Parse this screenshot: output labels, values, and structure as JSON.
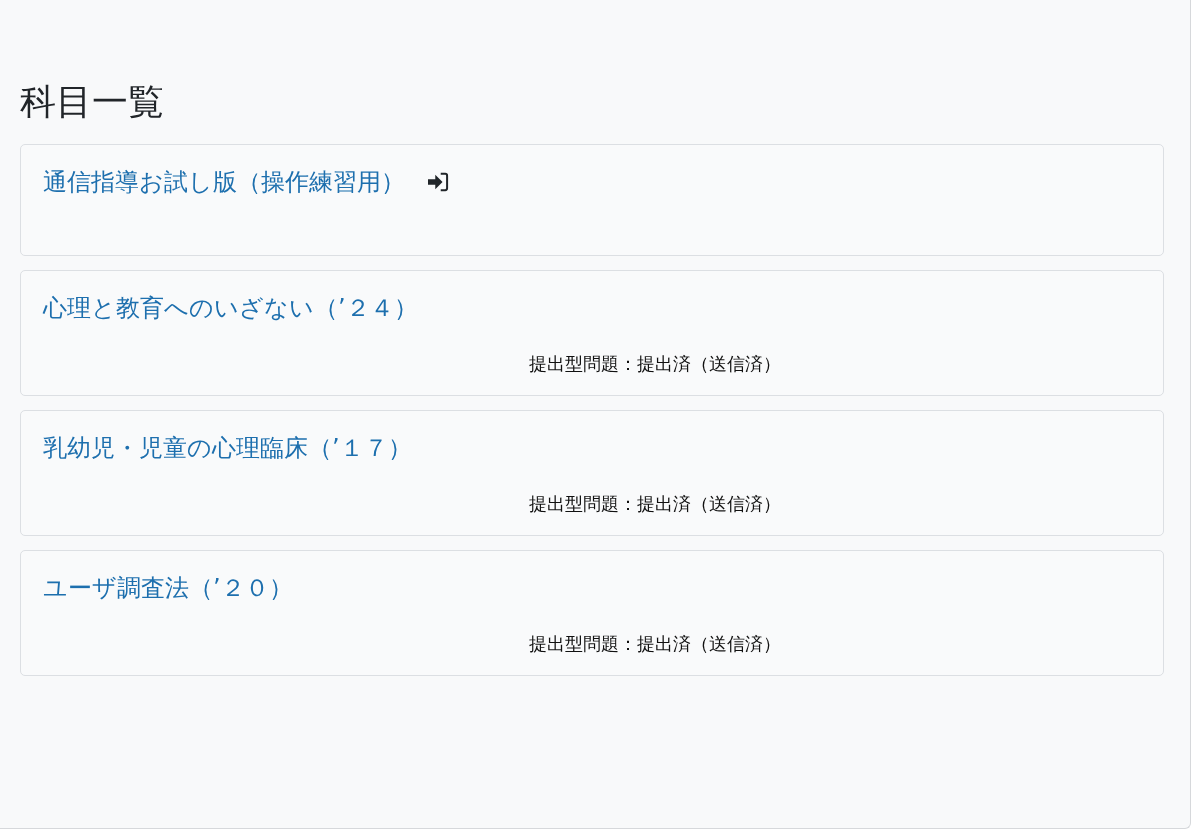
{
  "heading": "科目一覧",
  "courses": [
    {
      "title": "通信指導お試し版（操作練習用）",
      "enter_icon": true
    },
    {
      "title": "心理と教育へのいざない（’２４）",
      "enter_icon": false,
      "status": "提出型問題：提出済（送信済）"
    },
    {
      "title": "乳幼児・児童の心理臨床（’１７）",
      "enter_icon": false,
      "status": "提出型問題：提出済（送信済）"
    },
    {
      "title": "ユーザ調査法（’２０）",
      "enter_icon": false,
      "status": "提出型問題：提出済（送信済）"
    }
  ]
}
